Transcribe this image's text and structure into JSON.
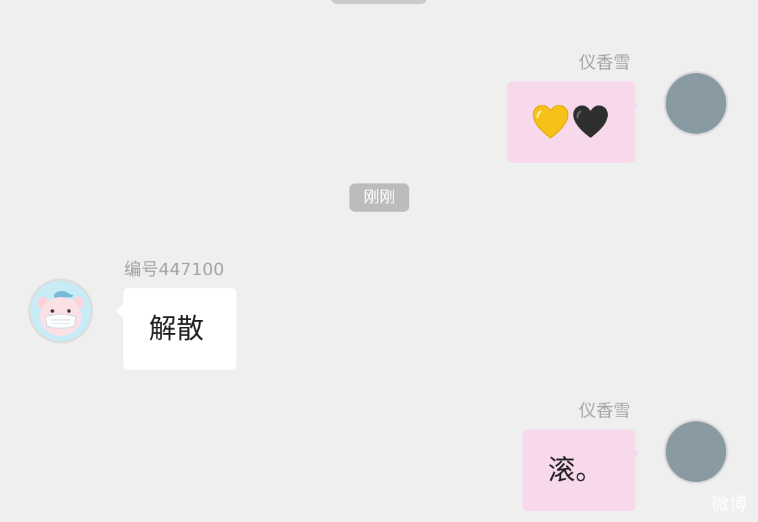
{
  "colors": {
    "background": "#efefef",
    "self_bubble": "#f8d9ec",
    "other_bubble": "#ffffff",
    "timestamp_pill": "#bcbcbc",
    "sender_name": "#a3a3a3",
    "self_avatar": "#8a9aa3",
    "pig_avatar_bg": "#c7ecf6"
  },
  "messages": [
    {
      "side": "right",
      "sender": "仪香雪",
      "content_icons": [
        "yellow-heart-icon",
        "black-heart-icon"
      ],
      "avatar": "gray-avatar"
    },
    {
      "side": "left",
      "sender": "编号447100",
      "text": "解散",
      "avatar": "pig-with-mask-avatar"
    },
    {
      "side": "right",
      "sender": "仪香雪",
      "text": "滚。",
      "avatar": "gray-avatar"
    }
  ],
  "timestamp": "刚刚",
  "watermark": "微博"
}
